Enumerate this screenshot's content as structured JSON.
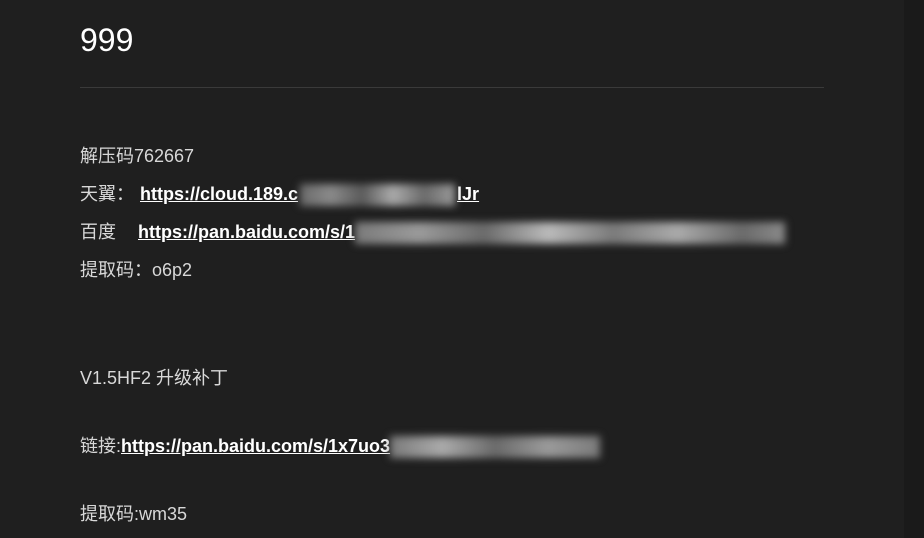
{
  "title": "999",
  "extract_code_line": "解压码762667",
  "tianyi": {
    "label": "天翼：",
    "link_prefix": "https://cloud.189.c",
    "link_suffix": "lJr"
  },
  "baidu1": {
    "label": "百度",
    "link_prefix": "https://pan.baidu.com/s/1"
  },
  "code1": {
    "label": "提取码：",
    "value": "o6p2"
  },
  "patch": {
    "title": "V1.5HF2 升级补丁"
  },
  "baidu2": {
    "label": "链接: ",
    "link_prefix": "https://pan.baidu.com/s/1x7uo3"
  },
  "code2": {
    "label": "提取码: ",
    "value": "wm35"
  }
}
